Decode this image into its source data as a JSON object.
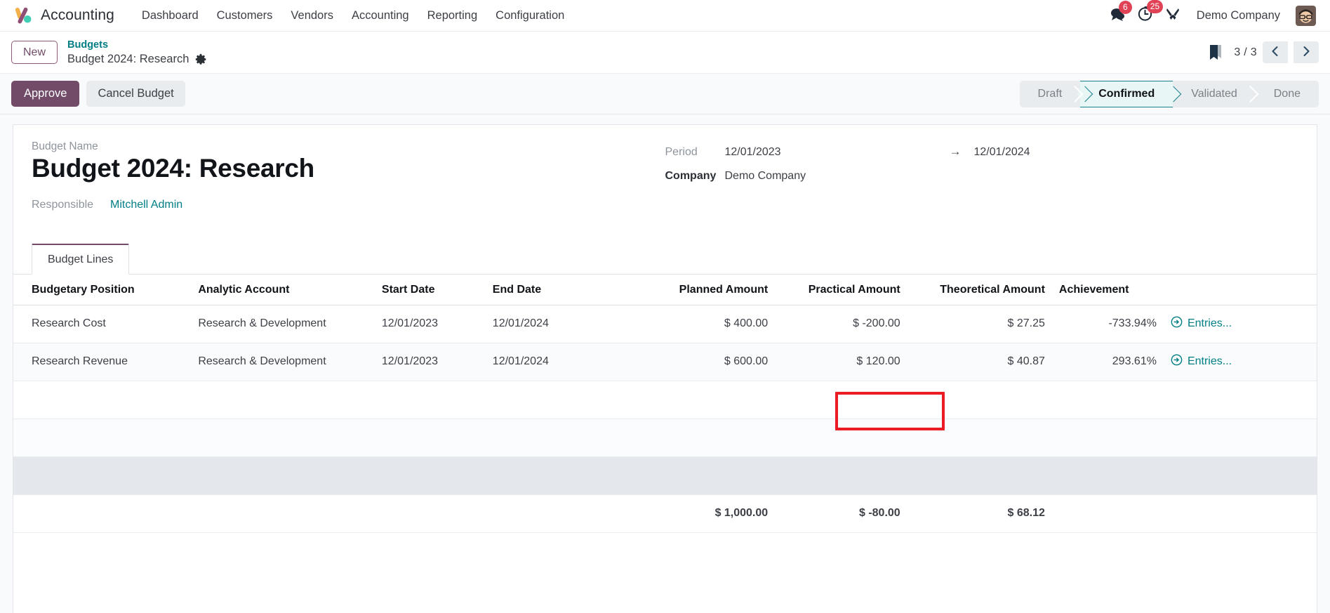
{
  "app": {
    "brand_name": "Accounting",
    "logo_icon": "odoo-logo-icon"
  },
  "navbar": {
    "menu_items": [
      {
        "label": "Dashboard"
      },
      {
        "label": "Customers"
      },
      {
        "label": "Vendors"
      },
      {
        "label": "Accounting"
      },
      {
        "label": "Reporting"
      },
      {
        "label": "Configuration"
      }
    ],
    "messages_icon": "chat-bubble-icon",
    "messages_count": "6",
    "activities_icon": "clock-icon",
    "activities_count": "25",
    "debug_icon": "tools-wrench-icon",
    "company": "Demo Company",
    "avatar_icon": "user-avatar"
  },
  "controlpanel": {
    "new_button": "New",
    "breadcrumb_parent": "Budgets",
    "breadcrumb_current": "Budget 2024: Research",
    "settings_icon": "gear-icon",
    "bookmark_icon": "bookmark-icon",
    "pager": "3 / 3",
    "prev_icon": "chevron-left-icon",
    "next_icon": "chevron-right-icon"
  },
  "actions": {
    "approve_label": "Approve",
    "cancel_label": "Cancel Budget",
    "approve_color": "#714b67"
  },
  "statusbar": {
    "active": "Confirmed",
    "active_color": "#1a7f8e",
    "steps": [
      {
        "label": "Draft"
      },
      {
        "label": "Confirmed"
      },
      {
        "label": "Validated"
      },
      {
        "label": "Done"
      }
    ]
  },
  "form": {
    "budget_name_label": "Budget Name",
    "budget_name_value": "Budget 2024: Research",
    "responsible_label": "Responsible",
    "responsible_value": "Mitchell Admin",
    "period_label": "Period",
    "period_start": "12/01/2023",
    "period_arrow": "→",
    "period_end": "12/01/2024",
    "company_label": "Company",
    "company_value": "Demo Company"
  },
  "notebook": {
    "tabs": [
      {
        "label": "Budget Lines"
      }
    ]
  },
  "table": {
    "headers": [
      "Budgetary Position",
      "Analytic Account",
      "Start Date",
      "End Date",
      "Planned Amount",
      "Practical Amount",
      "Theoretical Amount",
      "Achievement",
      ""
    ],
    "rows": [
      {
        "budgetary_position": "Research Cost",
        "analytic_account": "Research & Development",
        "start_date": "12/01/2023",
        "end_date": "12/01/2024",
        "planned_amount": "$ 400.00",
        "practical_amount": "$ -200.00",
        "theoretical_amount": "$ 27.25",
        "achievement": "-733.94%",
        "entries_label": "Entries...",
        "entries_icon": "circle-arrow-right-icon"
      },
      {
        "budgetary_position": "Research Revenue",
        "analytic_account": "Research & Development",
        "start_date": "12/01/2023",
        "end_date": "12/01/2024",
        "planned_amount": "$ 600.00",
        "practical_amount": "$ 120.00",
        "theoretical_amount": "$ 40.87",
        "achievement": "293.61%",
        "entries_label": "Entries...",
        "entries_icon": "circle-arrow-right-icon"
      }
    ],
    "totals": {
      "planned_amount": "$ 1,000.00",
      "practical_amount": "$ -80.00",
      "theoretical_amount": "$ 68.12"
    }
  },
  "annotation": {
    "highlight_color": "#ec1c24",
    "target": "practical-amount-cell-row-1"
  }
}
